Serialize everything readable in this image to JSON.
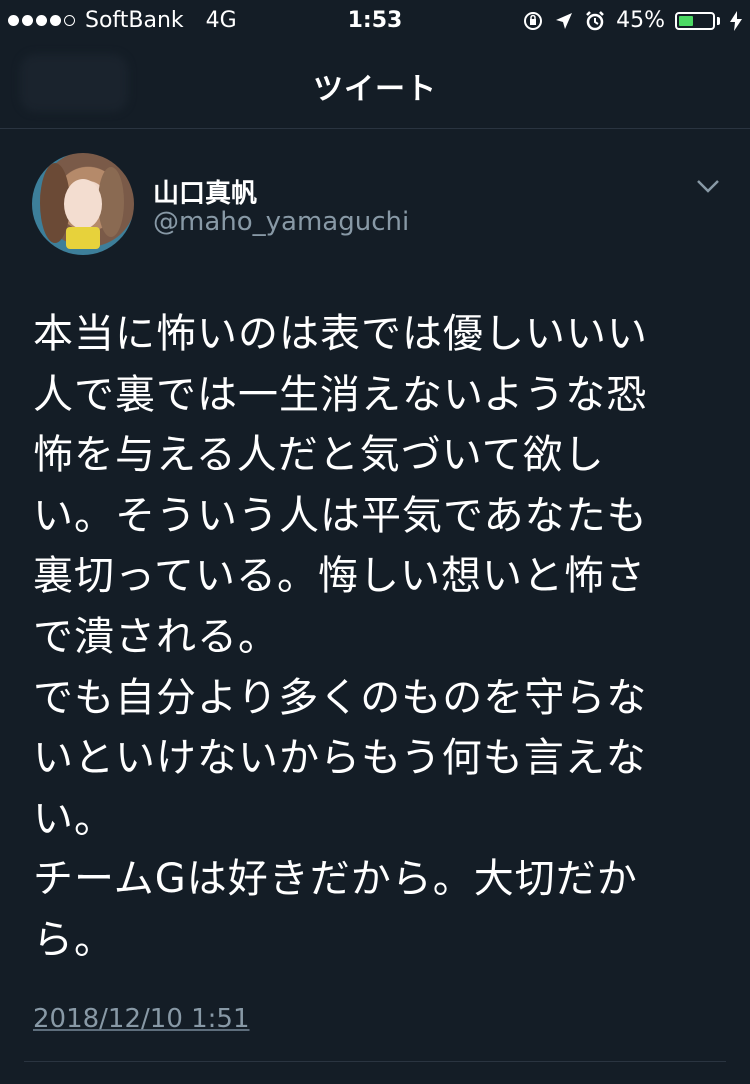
{
  "status_bar": {
    "carrier": "SoftBank",
    "network": "4G",
    "time": "1:53",
    "battery_percent": "45%",
    "battery_level": 0.45,
    "signal_bars_filled": 4,
    "signal_bars_total": 5
  },
  "nav": {
    "title": "ツイート"
  },
  "tweet": {
    "author_name": "山口真帆",
    "author_handle": "@maho_yamaguchi",
    "text_lines": [
      "本当に怖いのは表では優しいいい",
      "人で裏では一生消えないような恐",
      "怖を与える人だと気づいて欲し",
      "い。そういう人は平気であなたも",
      "裏切っている。悔しい想いと怖さ",
      "で潰される。",
      "でも自分より多くのものを守らな",
      "いといけないからもう何も言えな",
      "い。",
      "チームGは好きだから。大切だか",
      "ら。"
    ],
    "timestamp": "2018/12/10 1:51"
  },
  "colors": {
    "background": "#141d26",
    "text": "#ffffff",
    "secondary_text": "#8899a6",
    "battery_fill": "#4cd964"
  }
}
